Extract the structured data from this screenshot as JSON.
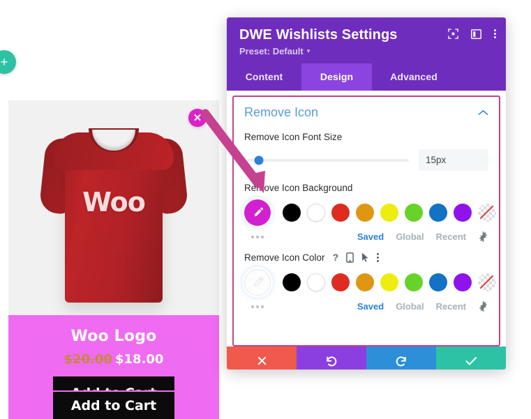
{
  "preview": {
    "add_module_icon": "plus-icon",
    "product": {
      "title": "Woo Logo",
      "price_old": "$20.00",
      "price_new": "$18.00",
      "add_to_cart_label": "Add to Cart",
      "image_text": "Woo",
      "remove_icon_glyph": "✕",
      "remove_icon_color": "#d922c8",
      "card_background": "#ef6bf2",
      "image_background": "#f1f1f1",
      "shirt_color": "#b02126"
    },
    "second_card": {
      "add_to_cart_label": "Add to Cart"
    }
  },
  "modal": {
    "title": "DWE Wishlists Settings",
    "preset_label": "Preset: Default",
    "preset_caret": "▾",
    "header_icons": [
      "focus-icon",
      "layout-panel-icon",
      "more-vertical-icon"
    ],
    "header_background": "#6f2dbd",
    "tabs": [
      {
        "label": "Content",
        "active": false
      },
      {
        "label": "Design",
        "active": true
      },
      {
        "label": "Advanced",
        "active": false
      }
    ],
    "active_tab_background": "#8b44e0",
    "section": {
      "title": "Remove Icon",
      "title_color": "#5b9bd5",
      "collapse_icon": "chevron-up-icon",
      "highlight_border_color": "#c6418f",
      "font_size": {
        "label": "Remove Icon Font Size",
        "value": "15px",
        "slider_percent": 9,
        "thumb_color": "#2f80d8"
      },
      "background": {
        "label": "Remove Icon Background",
        "picker_icon": "eyedropper-icon",
        "picker_color": "#d11fd1",
        "picker_filled": true,
        "more_icon": "more-horizontal-icon",
        "swatches": [
          {
            "name": "black",
            "hex": "#000000"
          },
          {
            "name": "white",
            "hex": "#ffffff"
          },
          {
            "name": "red",
            "hex": "#e02b20"
          },
          {
            "name": "orange",
            "hex": "#e09612"
          },
          {
            "name": "yellow",
            "hex": "#eded10"
          },
          {
            "name": "green",
            "hex": "#67d328"
          },
          {
            "name": "blue",
            "hex": "#1272c4"
          },
          {
            "name": "purple",
            "hex": "#9013ec"
          },
          {
            "name": "transparent",
            "hex": "transparent"
          }
        ],
        "tabs": [
          {
            "label": "Saved",
            "active": true
          },
          {
            "label": "Global",
            "active": false
          },
          {
            "label": "Recent",
            "active": false
          }
        ],
        "settings_icon": "gear-icon"
      },
      "color": {
        "label": "Remove Icon Color",
        "label_icons": [
          "help-icon",
          "mobile-icon",
          "cursor-icon",
          "more-vertical-icon"
        ],
        "picker_icon": "eyedropper-icon",
        "picker_filled": false,
        "more_icon": "more-horizontal-icon",
        "swatches": [
          {
            "name": "black",
            "hex": "#000000"
          },
          {
            "name": "white",
            "hex": "#ffffff"
          },
          {
            "name": "red",
            "hex": "#e02b20"
          },
          {
            "name": "orange",
            "hex": "#e09612"
          },
          {
            "name": "yellow",
            "hex": "#eded10"
          },
          {
            "name": "green",
            "hex": "#67d328"
          },
          {
            "name": "blue",
            "hex": "#1272c4"
          },
          {
            "name": "purple",
            "hex": "#9013ec"
          },
          {
            "name": "transparent",
            "hex": "transparent"
          }
        ],
        "tabs": [
          {
            "label": "Saved",
            "active": true
          },
          {
            "label": "Global",
            "active": false
          },
          {
            "label": "Recent",
            "active": false
          }
        ],
        "settings_icon": "gear-icon"
      }
    },
    "footer": [
      {
        "name": "cancel-button",
        "icon": "close-icon",
        "color": "#ef5a4c"
      },
      {
        "name": "undo-button",
        "icon": "undo-icon",
        "color": "#8b3fe0"
      },
      {
        "name": "redo-button",
        "icon": "redo-icon",
        "color": "#2d8fd8"
      },
      {
        "name": "save-button",
        "icon": "checkmark-icon",
        "color": "#2ec2a4"
      }
    ]
  },
  "annotation": {
    "arrow_color": "#c6418f",
    "arrow_name": "pointer-arrow"
  }
}
